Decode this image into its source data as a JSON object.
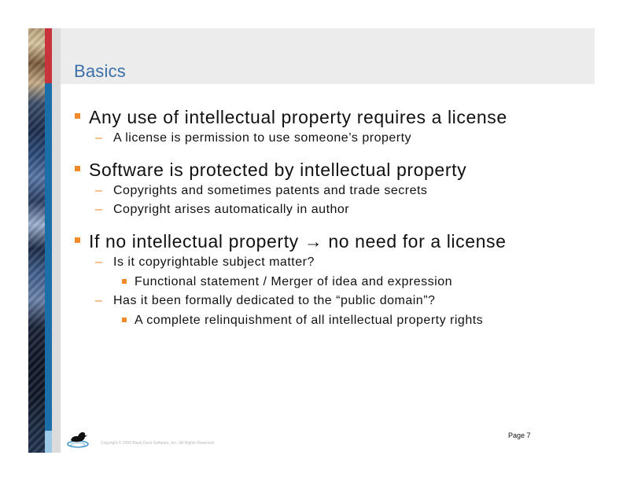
{
  "slide": {
    "title": "Basics",
    "page": "Page 7",
    "copyright": "Copyright © 2006 Black Duck Software, Inc., All Rights Reserved."
  },
  "content": {
    "p1": {
      "text": "Any use of intellectual property requires a license",
      "sub1": "A license is permission to use someone’s property"
    },
    "p2": {
      "text": "Software is protected by intellectual property",
      "sub1": "Copyrights and sometimes patents and trade secrets",
      "sub2": "Copyright arises automatically in author"
    },
    "p3": {
      "text": "If no intellectual property → no need for a license",
      "sub1": "Is it copyrightable subject matter?",
      "sub1_item": "Functional statement / Merger of idea and expression",
      "sub2": "Has it been formally dedicated to the “public domain”?",
      "sub2_item": "A complete relinquishment of all intellectual property rights"
    },
    "dash": "–"
  },
  "colors": {
    "title": "#3a6fa8",
    "bullet": "#f08a2b",
    "accent_red": "#c8343a",
    "accent_blue": "#1a6fa8"
  },
  "icons": {
    "logo": "duck-logo-icon"
  }
}
